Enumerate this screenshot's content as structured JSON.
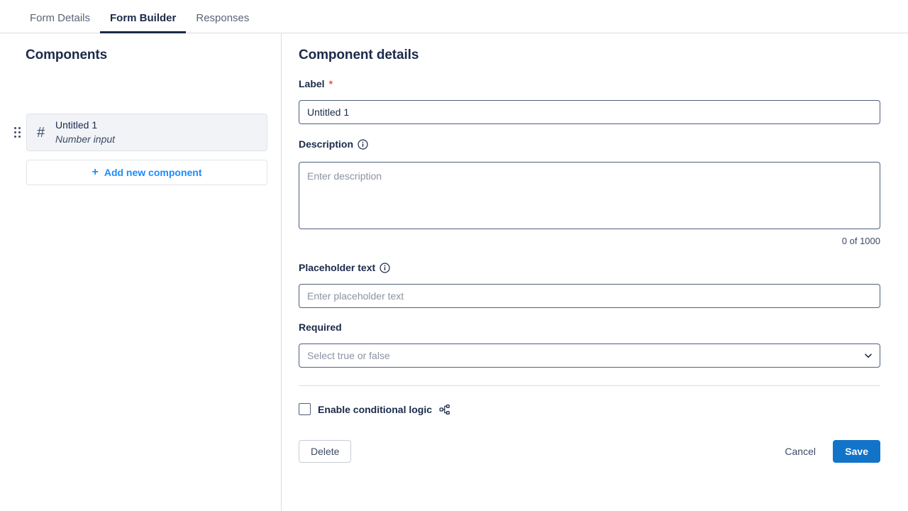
{
  "tabs": [
    {
      "label": "Form Details",
      "active": false
    },
    {
      "label": "Form Builder",
      "active": true
    },
    {
      "label": "Responses",
      "active": false
    }
  ],
  "sidebar": {
    "title": "Components",
    "component": {
      "icon": "number-hash-icon",
      "icon_glyph": "#",
      "name": "Untitled 1",
      "type": "Number input"
    },
    "add_button": {
      "plus": "+",
      "label": "Add new component"
    }
  },
  "main": {
    "title": "Component details",
    "label_field": {
      "label": "Label",
      "required_mark": "*",
      "value": "Untitled 1",
      "placeholder": ""
    },
    "description_field": {
      "label": "Description",
      "has_info_icon": true,
      "value": "",
      "placeholder": "Enter description",
      "counter": "0 of 1000",
      "max_length": 1000
    },
    "placeholder_field": {
      "label": "Placeholder text",
      "has_info_icon": true,
      "value": "",
      "placeholder": "Enter placeholder text"
    },
    "required_field": {
      "label": "Required",
      "selected": "Select true or false",
      "options": [
        "Select true or false",
        "true",
        "false"
      ]
    },
    "conditional_logic": {
      "label": "Enable conditional logic",
      "checked": false,
      "icon": "branch-icon"
    },
    "actions": {
      "delete": "Delete",
      "cancel": "Cancel",
      "save": "Save"
    }
  },
  "colors": {
    "accent_blue": "#1274c8",
    "link_blue": "#1a8cff",
    "navy": "#1b2a4a",
    "required_red": "#e8573f",
    "border": "#d9dde3",
    "input_border": "#50607c"
  }
}
